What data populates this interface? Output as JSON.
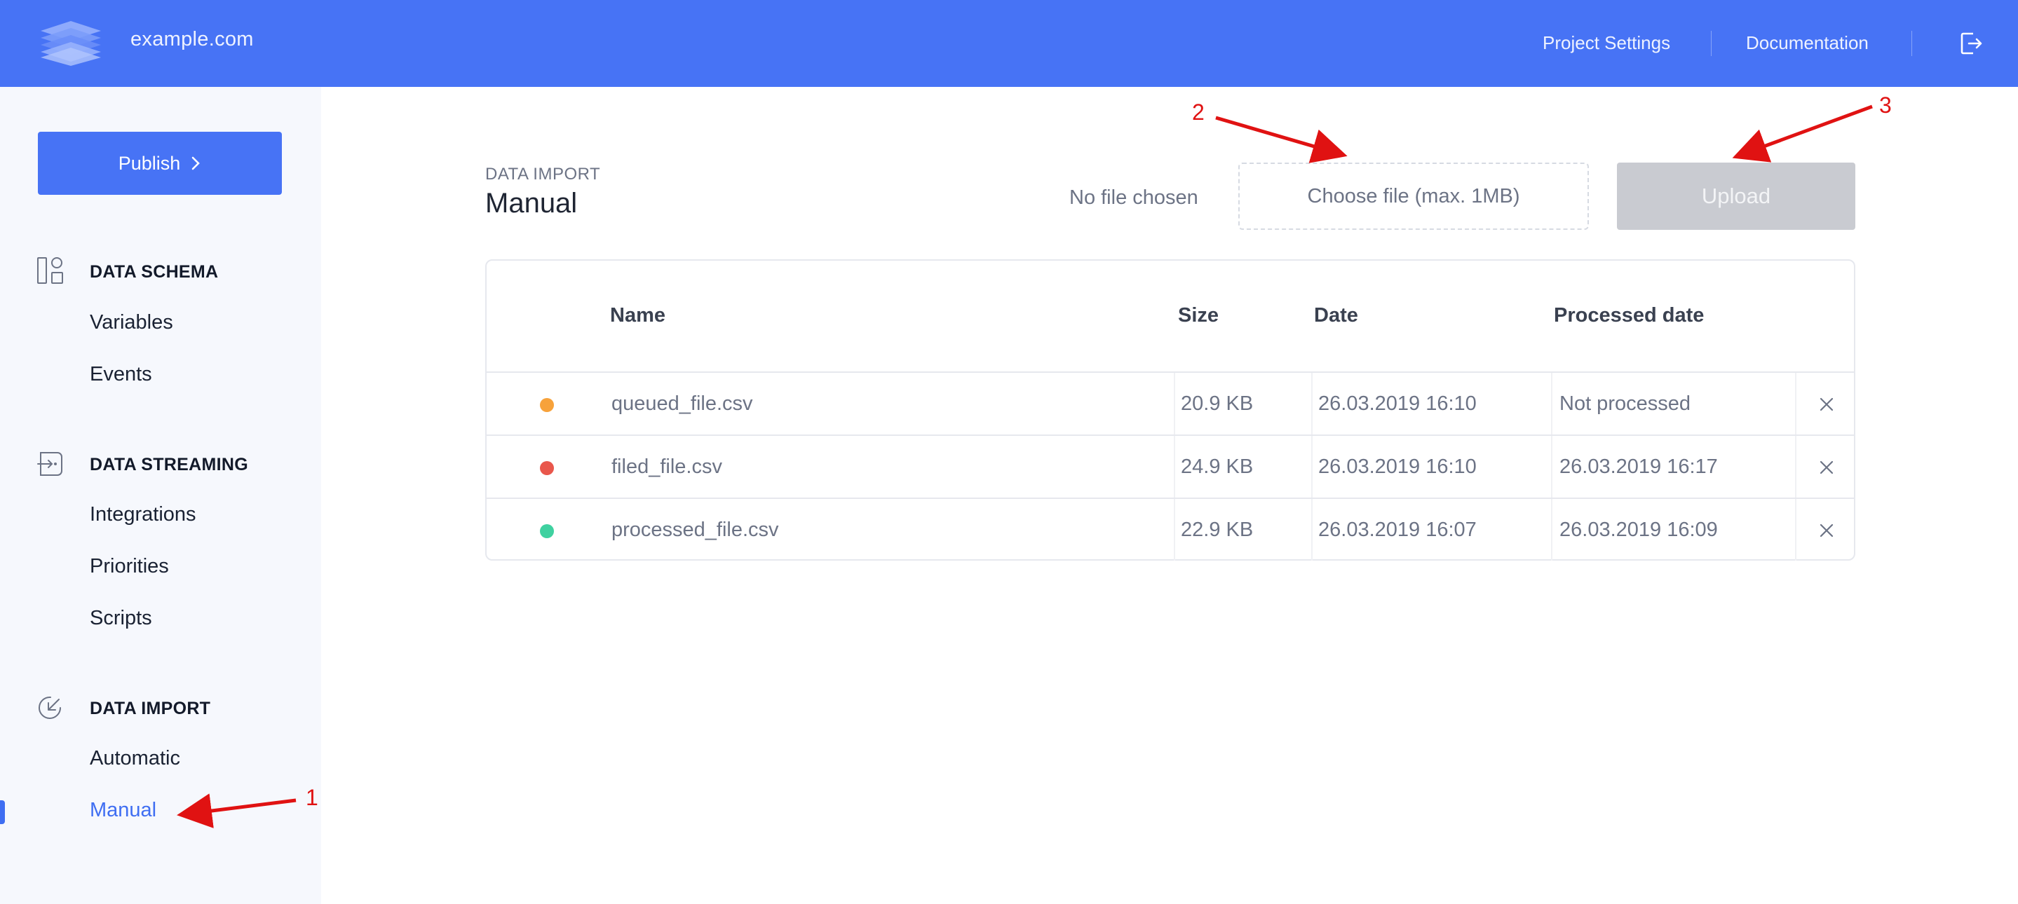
{
  "header": {
    "site_name": "example.com",
    "links": [
      "Project Settings",
      "Documentation"
    ],
    "logout_icon": "logout-icon"
  },
  "sidebar": {
    "publish_label": "Publish",
    "sections": [
      {
        "title": "DATA SCHEMA",
        "icon": "schema-icon",
        "items": [
          "Variables",
          "Events"
        ]
      },
      {
        "title": "DATA STREAMING",
        "icon": "streaming-icon",
        "items": [
          "Integrations",
          "Priorities",
          "Scripts"
        ]
      },
      {
        "title": "DATA IMPORT",
        "icon": "import-icon",
        "items": [
          "Automatic",
          "Manual"
        ]
      }
    ],
    "active_item": "Manual"
  },
  "main": {
    "kicker": "DATA IMPORT",
    "title": "Manual",
    "no_file_text": "No file chosen",
    "choose_file_label": "Choose file (max. 1MB)",
    "upload_label": "Upload"
  },
  "table": {
    "columns": [
      "Name",
      "Size",
      "Date",
      "Processed date"
    ],
    "rows": [
      {
        "status_color": "#f7a23b",
        "name": "queued_file.csv",
        "size": "20.9 KB",
        "date": "26.03.2019 16:10",
        "processed": "Not processed"
      },
      {
        "status_color": "#e9574c",
        "name": "filed_file.csv",
        "size": "24.9 KB",
        "date": "26.03.2019 16:10",
        "processed": "26.03.2019 16:17"
      },
      {
        "status_color": "#3fd1a0",
        "name": "processed_file.csv",
        "size": "22.9 KB",
        "date": "26.03.2019 16:07",
        "processed": "26.03.2019 16:09"
      }
    ]
  },
  "annotations": {
    "labels": [
      "1",
      "2",
      "3"
    ],
    "color": "#e01212"
  },
  "colors": {
    "brand": "#4773f5",
    "active": "#3f6ef2",
    "disabled_button": "#c9cbd1"
  }
}
